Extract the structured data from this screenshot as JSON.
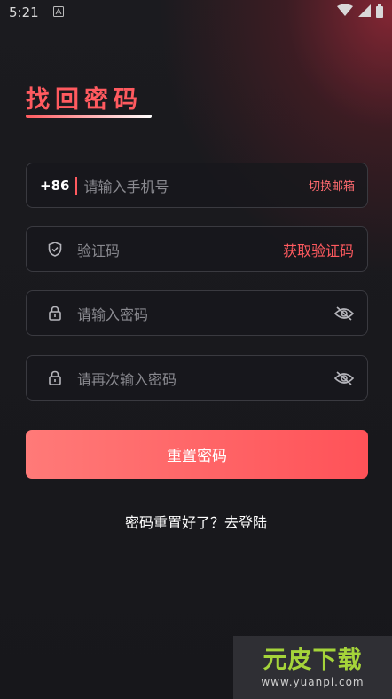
{
  "status_bar": {
    "time": "5:21"
  },
  "page": {
    "title": "找回密码"
  },
  "form": {
    "phone": {
      "country_code": "+86",
      "placeholder": "请输入手机号",
      "switch_label": "切换邮箱"
    },
    "code": {
      "placeholder": "验证码",
      "get_code_label": "获取验证码"
    },
    "password": {
      "placeholder": "请输入密码"
    },
    "confirm_password": {
      "placeholder": "请再次输入密码"
    },
    "submit_label": "重置密码"
  },
  "footer": {
    "login_link": "密码重置好了？去登陆"
  },
  "watermark": {
    "logo": "元皮下载",
    "url": "www.yuanpi.com"
  },
  "colors": {
    "accent": "#ff5a5f",
    "background": "#17171b"
  }
}
